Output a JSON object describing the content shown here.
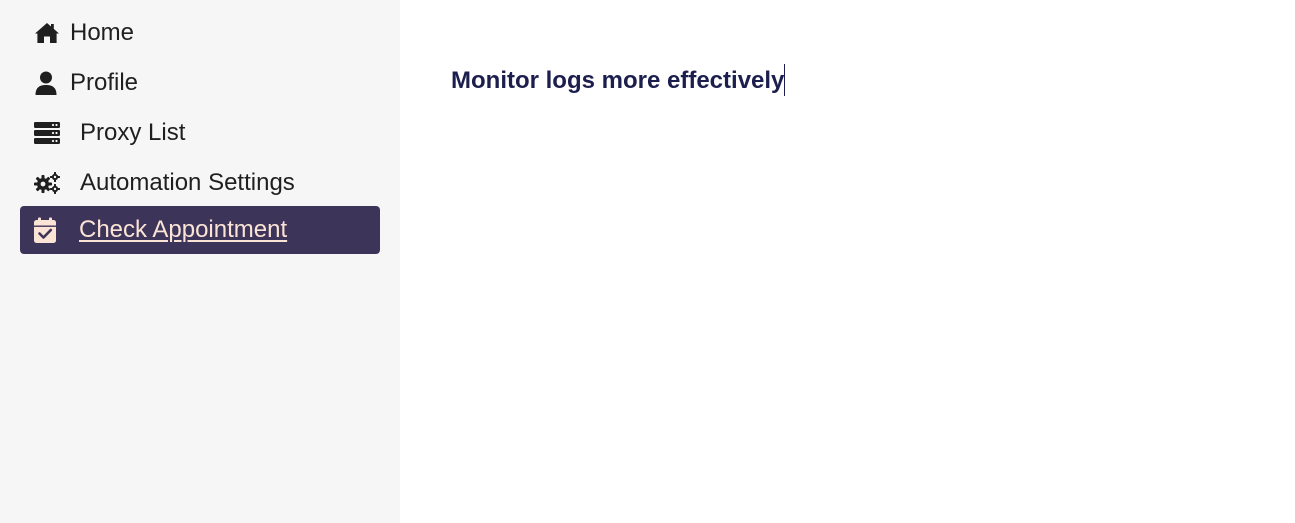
{
  "sidebar": {
    "items": [
      {
        "label": "Home",
        "icon": "home-icon"
      },
      {
        "label": "Profile",
        "icon": "user-icon"
      },
      {
        "label": "Proxy List",
        "icon": "server-icon"
      },
      {
        "label": "Automation Settings",
        "icon": "gears-icon"
      },
      {
        "label": "Check Appointment",
        "icon": "calendar-check-icon",
        "active": true
      }
    ]
  },
  "main": {
    "headline": "Monitor logs more effectively"
  },
  "colors": {
    "sidebar_bg": "#f6f6f6",
    "active_bg": "#3d3559",
    "active_text": "#fbe3d6",
    "headline": "#1c1f4d"
  }
}
